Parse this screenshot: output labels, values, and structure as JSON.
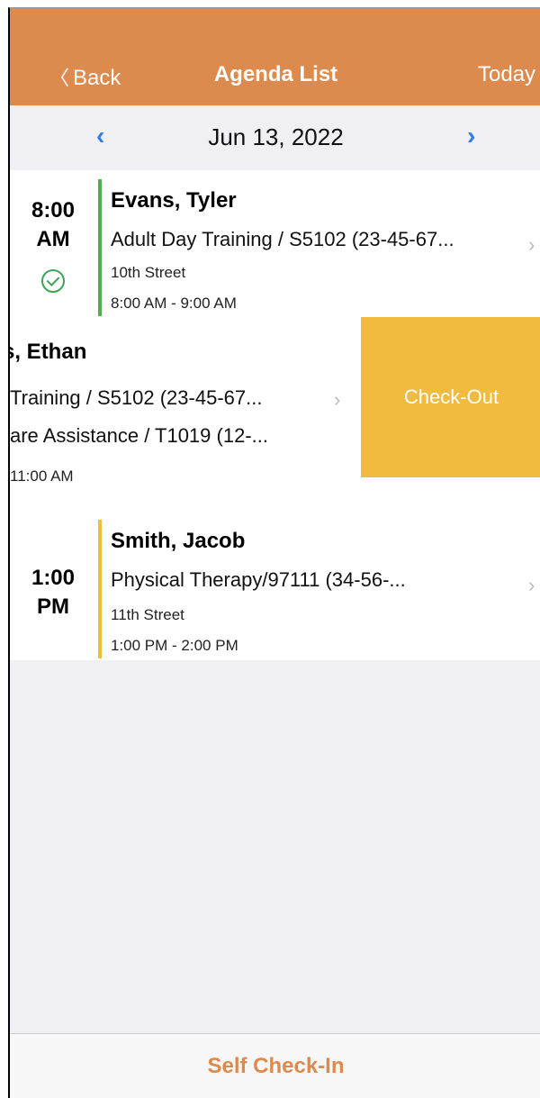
{
  "nav": {
    "back_label": "Back",
    "back_chevron": "〈",
    "title": "Agenda List",
    "today_label": "Today"
  },
  "datebar": {
    "date": "Jun 13, 2022",
    "prev_glyph": "‹",
    "next_glyph": "›"
  },
  "appointments": [
    {
      "time_line1": "8:00",
      "time_line2": "AM",
      "status": "checked-in",
      "name": "Evans, Tyler",
      "service": "Adult Day Training / S5102 (23-45-67...",
      "location": "10th Street",
      "time_range": "8:00 AM - 9:00 AM",
      "bar_color": "#4caf50"
    },
    {
      "name": "s, Ethan",
      "service1": "Training / S5102 (23-45-67...",
      "service2": "are Assistance / T1019 (12-...",
      "time_range": "11:00 AM",
      "action_label": "Check-Out"
    },
    {
      "time_line1": "1:00",
      "time_line2": "PM",
      "name": "Smith, Jacob",
      "service": "Physical Therapy/97111 (34-56-...",
      "location": "11th Street",
      "time_range": "1:00 PM - 2:00 PM",
      "bar_color": "#f1bb3f"
    }
  ],
  "bottom": {
    "self_checkin_label": "Self Check-In"
  },
  "colors": {
    "header": "#dc8a4e",
    "accent_blue": "#2f7bf5",
    "checkout": "#f1bb3f"
  }
}
